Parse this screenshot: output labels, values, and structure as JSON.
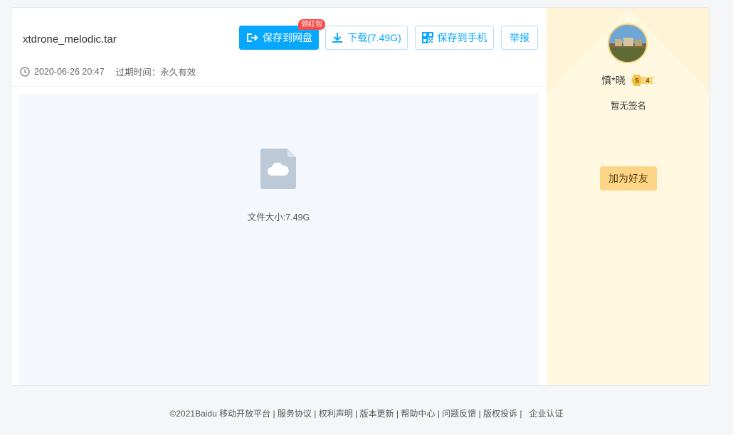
{
  "file": {
    "name": "xtdrone_melodic.tar",
    "date": "2020-06-26 20:47",
    "expire_label": "过期时间：永久有效",
    "size_label": "文件大小:7.49G"
  },
  "toolbar": {
    "save_label": "保存到网盘",
    "badge_label": "领红包",
    "download_label": "下载(7.49G)",
    "phone_label": "保存到手机",
    "report_label": "举报"
  },
  "user": {
    "name": "慎*晓",
    "level": "4",
    "level_prefix": "S",
    "signature": "暂无签名",
    "add_friend_label": "加为好友"
  },
  "footer": {
    "links": [
      "©2021Baidu 移动开放平台",
      "服务协议",
      "权利声明",
      "版本更新",
      "帮助中心",
      "问题反馈",
      "版权投诉",
      "企业认证"
    ]
  },
  "colors": {
    "primary": "#06a7ff",
    "side_bg": "#fff8e1",
    "add_friend_bg": "#fdd587",
    "badge": "#f2504e"
  },
  "icons": [
    "save-icon",
    "download-icon",
    "qrcode-icon",
    "clock-icon",
    "file-cloud-icon",
    "level-badge-icon"
  ]
}
